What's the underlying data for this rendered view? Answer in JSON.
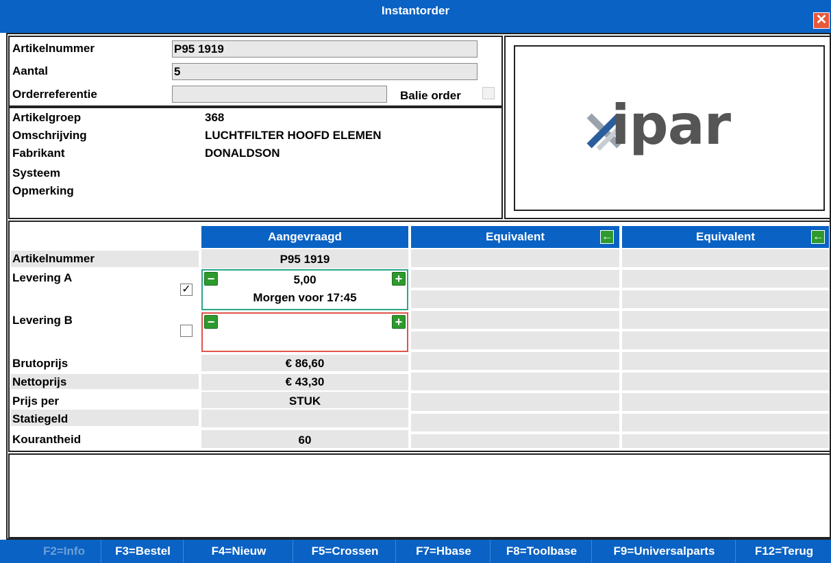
{
  "window": {
    "title": "Instantorder"
  },
  "order": {
    "artikelnummer_label": "Artikelnummer",
    "artikelnummer_value": "P95 1919",
    "aantal_label": "Aantal",
    "aantal_value": "5",
    "orderref_label": "Orderreferentie",
    "orderref_value": "",
    "balie_label": "Balie order"
  },
  "article": {
    "groep_label": "Artikelgroep",
    "groep_value": "368",
    "omschrijving_label": "Omschrijving",
    "omschrijving_value": "LUCHTFILTER HOOFD ELEMEN",
    "fabrikant_label": "Fabrikant",
    "fabrikant_value": "DONALDSON",
    "systeem_label": "Systeem",
    "opmerking_label": "Opmerking"
  },
  "logo": {
    "text": "ipar"
  },
  "grid": {
    "col_aangevraagd": "Aangevraagd",
    "col_equiv1": "Equivalent",
    "col_equiv2": "Equivalent",
    "rows": {
      "artikelnummer": "Artikelnummer",
      "levering_a": "Levering A",
      "levering_b": "Levering B",
      "brutoprijs": "Brutoprijs",
      "nettoprijs": "Nettoprijs",
      "prijs_per": "Prijs per",
      "statiegeld": "Statiegeld",
      "kourantheid": "Kourantheid"
    },
    "values": {
      "artikelnummer": "P95 1919",
      "levering_a_qty": "5,00",
      "levering_a_time": "Morgen voor 17:45",
      "levering_a_checked": true,
      "levering_b_checked": false,
      "brutoprijs": "€ 86,60",
      "nettoprijs": "€ 43,30",
      "prijs_per": "STUK",
      "kourantheid": "60"
    }
  },
  "fkeys": [
    {
      "label": "F2=Info",
      "enabled": false
    },
    {
      "label": "F3=Bestel",
      "enabled": true
    },
    {
      "label": "F4=Nieuw",
      "enabled": true
    },
    {
      "label": "F5=Crossen",
      "enabled": true
    },
    {
      "label": "F7=Hbase",
      "enabled": true
    },
    {
      "label": "F8=Toolbase",
      "enabled": true
    },
    {
      "label": "F9=Universalparts",
      "enabled": true
    },
    {
      "label": "F12=Terug",
      "enabled": true
    }
  ],
  "colors": {
    "titlebar": "#0a62c4",
    "green_border": "#2aa58a",
    "red_border": "#e0524a"
  }
}
